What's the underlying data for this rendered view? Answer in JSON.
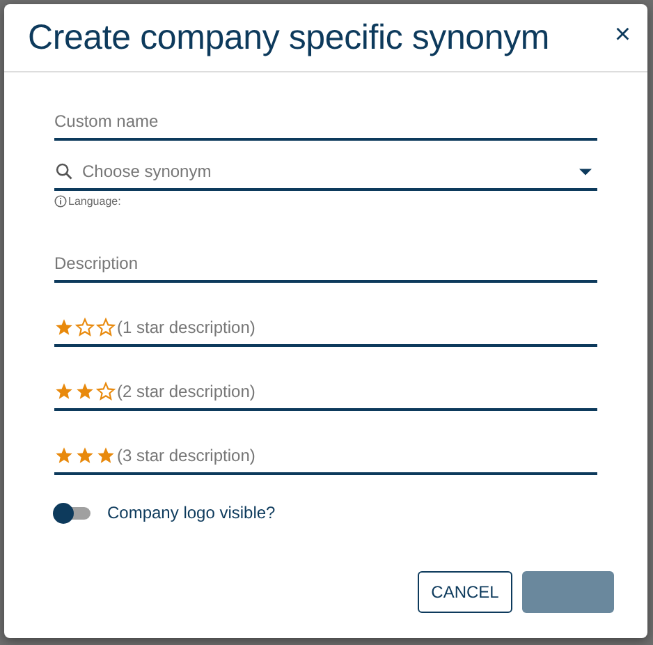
{
  "dialog": {
    "title": "Create company specific synonym",
    "close": "×"
  },
  "fields": [
    {
      "kind": "text",
      "placeholder": "Custom name"
    },
    {
      "kind": "select",
      "placeholder": "Choose synonym",
      "hint": "Language:"
    },
    {
      "kind": "text",
      "placeholder": "Description"
    }
  ],
  "ratings": [
    {
      "stars": 1,
      "placeholder": "(1 star description)"
    },
    {
      "stars": 2,
      "placeholder": "(2 star description)"
    },
    {
      "stars": 3,
      "placeholder": "(3 star description)"
    }
  ],
  "toggle": {
    "label": "Company logo visible?",
    "on": false
  },
  "buttons": [
    {
      "kind": "outline",
      "label": "CANCEL",
      "disabled": false
    },
    {
      "kind": "primary",
      "disabled": true
    }
  ]
}
